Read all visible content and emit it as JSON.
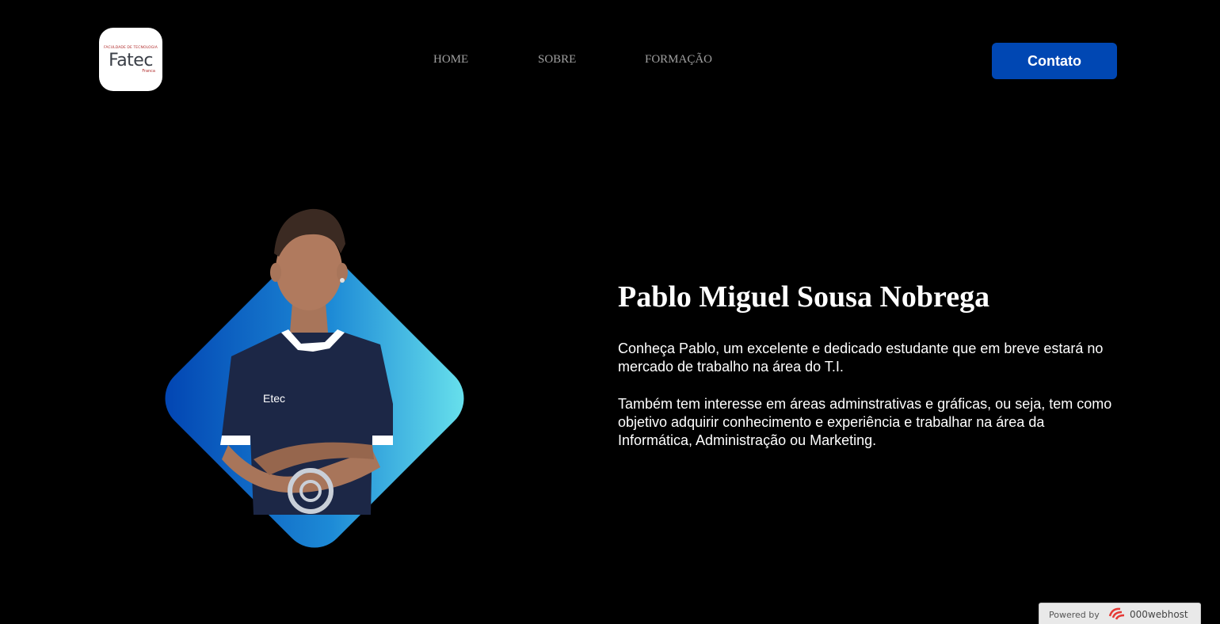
{
  "logo": {
    "top_text": "FACULDADE DE TECNOLOGIA",
    "main_text": "Fatec",
    "sub_text": "Franca"
  },
  "nav": {
    "items": [
      {
        "label": "HOME"
      },
      {
        "label": "SOBRE"
      },
      {
        "label": "FORMAÇÃO"
      }
    ]
  },
  "header": {
    "contact_label": "Contato"
  },
  "hero": {
    "title": "Pablo Miguel Sousa Nobrega",
    "paragraph1": "Conheça Pablo, um excelente e dedicado estudante que em breve estará no mercado de trabalho na área do T.I.",
    "paragraph2": "Também tem interesse em áreas adminstrativas e gráficas, ou seja, tem como objetivo adquirir conhecimento e experiência e trabalhar na área da Informática, Administração ou Marketing.",
    "shirt_text": "Etec"
  },
  "footer": {
    "powered_label": "Powered by",
    "powered_brand": "000webhost"
  },
  "colors": {
    "background": "#000000",
    "accent": "#0047b3",
    "diamond_light": "#5fe0e8",
    "diamond_dark": "#0047b3"
  }
}
